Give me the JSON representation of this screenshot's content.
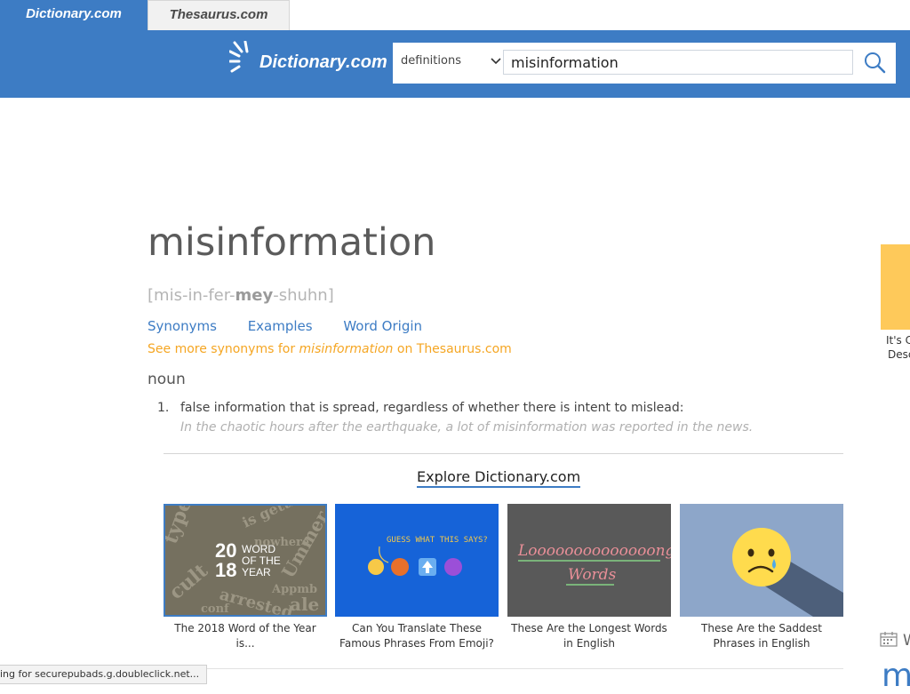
{
  "tabs": [
    {
      "label": "Dictionary.com",
      "active": true
    },
    {
      "label": "Thesaurus.com",
      "active": false
    }
  ],
  "header": {
    "logo_text": "Dictionary.com",
    "search": {
      "type_label": "definitions",
      "query": "misinformation"
    }
  },
  "entry": {
    "headword": "misinformation",
    "pronunciation": {
      "open": "[",
      "pre": "mis-in-fer-",
      "stress": "mey",
      "post": "-shuhn",
      "close": "]"
    },
    "links": [
      "Synonyms",
      "Examples",
      "Word Origin"
    ],
    "see_more": {
      "prefix": "See more synonyms for ",
      "word": "misinformation",
      "suffix": " on Thesaurus.com"
    },
    "part_of_speech": "noun",
    "definitions": [
      {
        "number": "1.",
        "text": "false information that is spread, regardless of whether there is intent to mislead:",
        "example": "In the chaotic hours after the earthquake, a lot of misinformation was reported in the news."
      }
    ]
  },
  "explore": {
    "heading": "Explore Dictionary.com",
    "cards": [
      {
        "caption": "The 2018 Word of the Year is...",
        "thumb_text": [
          "20",
          "18",
          "WORD",
          "OF THE",
          "YEAR"
        ]
      },
      {
        "caption": "Can You Translate These Famous Phrases From Emoji?",
        "thumb_text": [
          "GUESS WHAT THIS SAYS?"
        ]
      },
      {
        "caption": "These Are the Longest Words in English",
        "thumb_text": [
          "Loooooooooooooong",
          "Words"
        ]
      },
      {
        "caption": "These Are the Saddest Phrases in English",
        "thumb_text": []
      }
    ]
  },
  "sidebar": {
    "ad_line1": "It's C",
    "ad_line2": "Desc",
    "partial_w": "W",
    "partial_m": "m"
  },
  "status_bar": "ing for securepubads.g.doubleclick.net...",
  "colors": {
    "brand_blue": "#3d7cc4",
    "orange": "#f5a623",
    "ad_yellow": "#fec95a"
  }
}
